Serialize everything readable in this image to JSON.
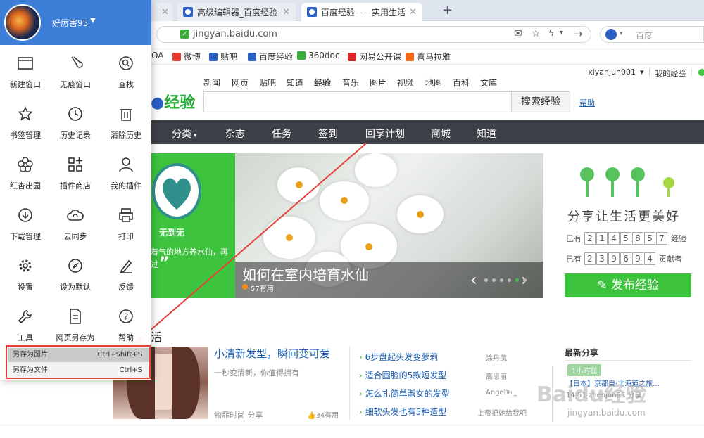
{
  "tabs": [
    {
      "label": ""
    },
    {
      "label": "高级编辑器_百度经验"
    },
    {
      "label": "百度经验——实用生活指南"
    }
  ],
  "new_tab": "+",
  "address": {
    "url": "jingyan.baidu.com",
    "search_placeholder": "百度"
  },
  "bookmarks": [
    {
      "label": "OA"
    },
    {
      "label": "微博"
    },
    {
      "label": "贴吧"
    },
    {
      "label": "百度经验"
    },
    {
      "label": "360doc"
    },
    {
      "label": "网易公开课"
    },
    {
      "label": "喜马拉雅"
    }
  ],
  "site": {
    "user": "xiyanjun001",
    "my_jingyan": "我的经验",
    "nav_top": [
      "新闻",
      "网页",
      "贴吧",
      "知道",
      "经验",
      "音乐",
      "图片",
      "视频",
      "地图",
      "百科",
      "文库"
    ],
    "logo_text": "经验",
    "search_button": "搜索经验",
    "help": "帮助",
    "nav_bar": [
      "分类",
      "杂志",
      "任务",
      "签到",
      "回享计划",
      "商城",
      "知道"
    ],
    "banner": {
      "left_title": "无到无",
      "left_text": "着气的地方养水仙，再",
      "left_text2": "过",
      "title": "如何在室内培育水仙",
      "sub": "57有用"
    },
    "slogan": "分享让生活更美好",
    "stats": [
      {
        "prefix": "已有",
        "digits": [
          "2",
          "1",
          "4",
          "5",
          "8",
          "5",
          "7"
        ],
        "suffix": "经验"
      },
      {
        "prefix": "已有",
        "digits": [
          "2",
          "3",
          "9",
          "6",
          "9",
          "4"
        ],
        "suffix": "贡献者"
      }
    ],
    "publish": "发布经验",
    "section_title": "活",
    "article": {
      "title": "小清新发型，瞬间变可爱",
      "desc": "一秒变清新，你值得拥有",
      "meta": "物菲时尚   分享",
      "count": "34有用"
    },
    "list": [
      {
        "title": "6步盘起头发变萝莉",
        "author": "涂丹凤"
      },
      {
        "title": "适合圆脸的5款短发型",
        "author": "高思丽"
      },
      {
        "title": "怎么扎简单淑女的发型",
        "author": "Angel℡_"
      },
      {
        "title": "细软头发也有5种造型",
        "author": "上帝把她给我吧"
      }
    ],
    "latest": "最新分享",
    "latest_items": [
      "1小时前",
      "【日本】京都自·北海道之旅...",
      "14:51 zhenjun95 分享"
    ],
    "watermark": "Baidu经验",
    "watermark_sub": "jingyan.baidu.com"
  },
  "menu": {
    "username": "好厉害95",
    "items": [
      {
        "label": "新建窗口",
        "icon": "window-icon"
      },
      {
        "label": "无痕窗口",
        "icon": "incognito-icon"
      },
      {
        "label": "查找",
        "icon": "find-icon"
      },
      {
        "label": "书签管理",
        "icon": "star-icon"
      },
      {
        "label": "历史记录",
        "icon": "clock-icon"
      },
      {
        "label": "清除历史",
        "icon": "trash-icon"
      },
      {
        "label": "红杏出园",
        "icon": "flower-icon"
      },
      {
        "label": "插件商店",
        "icon": "apps-icon"
      },
      {
        "label": "我的插件",
        "icon": "person-icon"
      },
      {
        "label": "下载管理",
        "icon": "download-icon"
      },
      {
        "label": "云同步",
        "icon": "cloud-icon"
      },
      {
        "label": "打印",
        "icon": "printer-icon"
      },
      {
        "label": "设置",
        "icon": "gear-icon"
      },
      {
        "label": "设为默认",
        "icon": "compass-icon"
      },
      {
        "label": "反馈",
        "icon": "pen-icon"
      },
      {
        "label": "工具",
        "icon": "wrench-icon"
      },
      {
        "label": "网页另存为",
        "icon": "document-icon"
      },
      {
        "label": "帮助",
        "icon": "question-icon"
      }
    ],
    "submenu": [
      {
        "label": "另存为图片",
        "shortcut": "Ctrl+Shift+S"
      },
      {
        "label": "另存为文件",
        "shortcut": "Ctrl+S"
      }
    ]
  },
  "colors": {
    "accent": "#3ec33e",
    "menu_header": "#3d7ed8",
    "highlight": "#e8413a"
  }
}
